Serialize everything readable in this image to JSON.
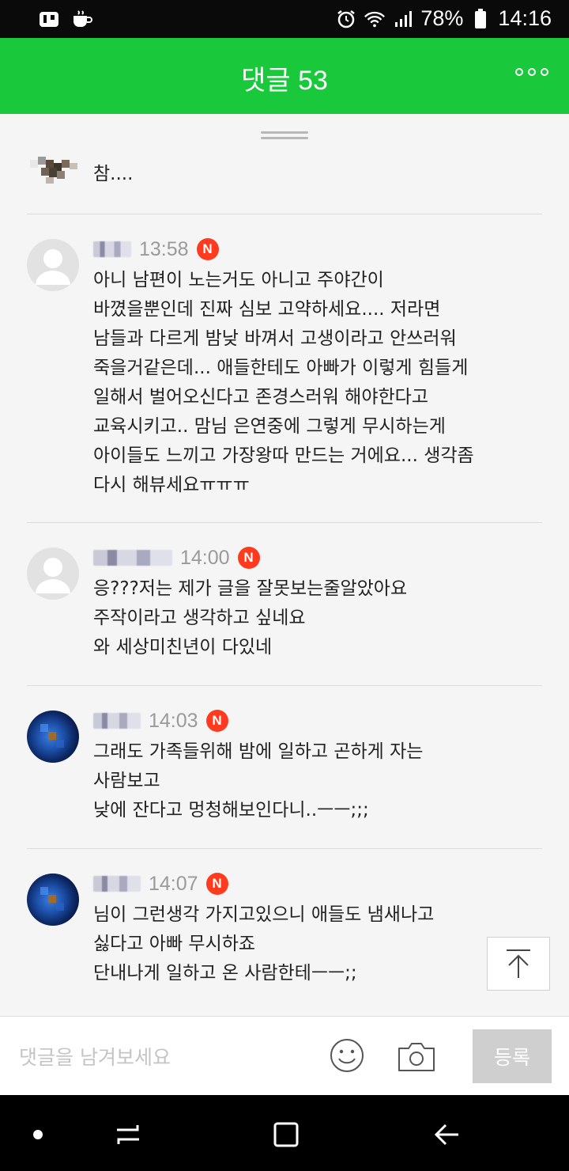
{
  "status_bar": {
    "battery": "78%",
    "time": "14:16",
    "left_icons": [
      "app-notification-icon",
      "coffee-icon"
    ],
    "right_icons": [
      "alarm-icon",
      "wifi-icon",
      "signal-icon",
      "battery-icon"
    ]
  },
  "header": {
    "title": "댓글 53",
    "background": "#19c83b",
    "more_icon": "more-icon"
  },
  "comments": [
    {
      "avatar": "pixelated-image",
      "nickname_hidden": true,
      "time": "",
      "new_badge": "",
      "text": "참...."
    },
    {
      "avatar": "default-user",
      "nickname_hidden": true,
      "time": "13:58",
      "new_badge": "N",
      "text": "아니 남편이 노는거도 아니고 주야간이\n바꼈을뿐인데 진짜 심보 고약하세요.... 저라면\n남들과 다르게 밤낮 바껴서 고생이라고 안쓰러워\n죽을거같은데... 애들한테도 아빠가 이렇게 힘들게\n일해서 벌어오신다고 존경스러워 해야한다고\n교육시키고.. 맘님 은연중에 그렇게 무시하는게\n아이들도 느끼고 가장왕따 만드는 거에요... 생각좀\n다시 해뷰세요ㅠㅠㅠ"
    },
    {
      "avatar": "default-user",
      "nickname_hidden": true,
      "time": "14:00",
      "new_badge": "N",
      "text": "응???저는 제가 글을 잘못보는줄알았아요\n주작이라고 생각하고 싶네요\n와 세상미친년이 다있네"
    },
    {
      "avatar": "blue-flower",
      "nickname_hidden": true,
      "time": "14:03",
      "new_badge": "N",
      "text": "그래도 가족들위해 밤에 일하고 곤하게 자는\n사람보고\n낮에 잔다고 멍청해보인다니..ㅡㅡ;;;"
    },
    {
      "avatar": "blue-flower",
      "nickname_hidden": true,
      "time": "14:07",
      "new_badge": "N",
      "text": "님이 그런생각 가지고있으니 애들도 냄새나고\n싫다고 아빠 무시하죠\n단내나게 일하고 온 사람한테ㅡㅡ;;"
    }
  ],
  "scroll_top": {
    "icon": "arrow-up-icon"
  },
  "input_bar": {
    "placeholder": "댓글을 남겨보세요",
    "value": "",
    "emoji_icon": "smiley-icon",
    "camera_icon": "camera-icon",
    "submit_label": "등록"
  },
  "nav_bar": {
    "buttons": [
      "home-dot-icon",
      "recent-apps-icon",
      "overview-icon",
      "back-icon"
    ]
  }
}
